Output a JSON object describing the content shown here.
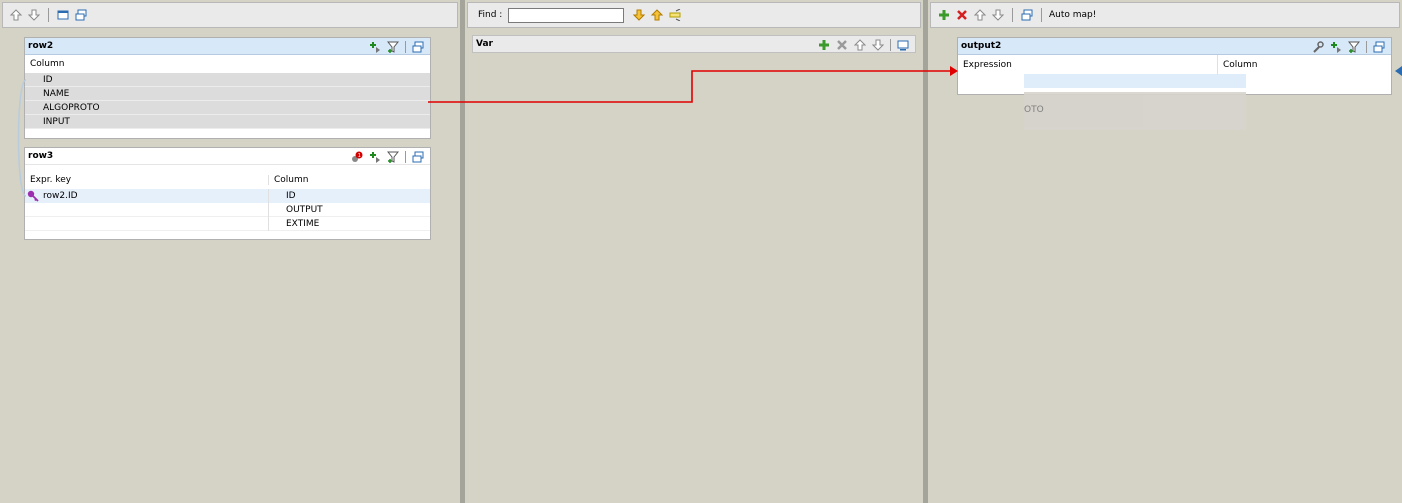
{
  "left_panel": {
    "toolbar": {
      "icons": [
        "move-up-icon",
        "move-down-icon",
        "window-icon",
        "minimize-all-icon"
      ]
    },
    "row2": {
      "title": "row2",
      "column_header": "Column",
      "columns": [
        "ID",
        "NAME",
        "ALGOPROTO",
        "INPUT"
      ]
    },
    "row3": {
      "title": "row3",
      "expr_key_header": "Expr. key",
      "column_header": "Column",
      "key_expr": "row2.ID",
      "columns": [
        "ID",
        "OUTPUT",
        "EXTIME"
      ]
    }
  },
  "mid_panel": {
    "find_label": "Find :",
    "find_value": "",
    "var_title": "Var"
  },
  "right_panel": {
    "toolbar": {
      "auto_map_label": "Auto map!"
    },
    "output2": {
      "title": "output2",
      "expression_header": "Expression",
      "column_header": "Column",
      "drag_ghost_text": "OTO"
    }
  },
  "colors": {
    "background": "#d4d3c6",
    "header_blue": "#d7e8f9",
    "link_red": "#e00000",
    "row_gray": "#dcdcdc"
  }
}
